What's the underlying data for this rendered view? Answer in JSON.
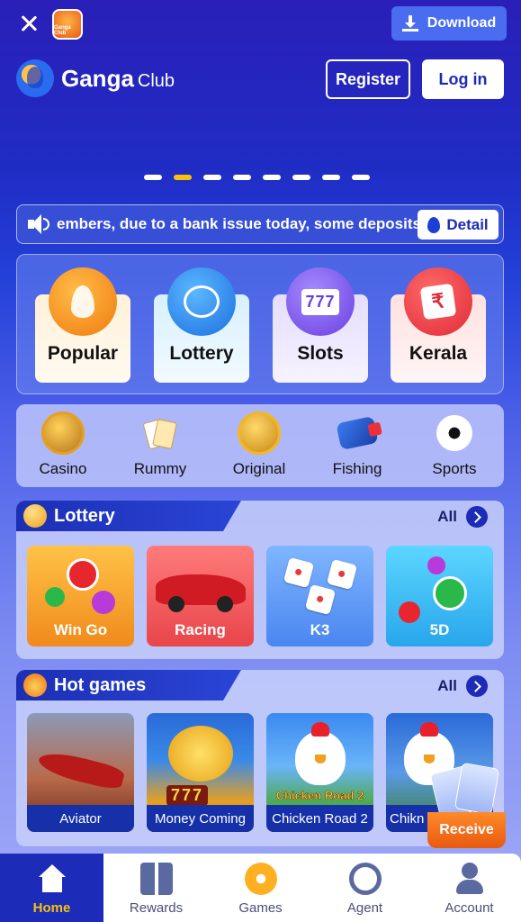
{
  "topbar": {
    "app_icon_label": "Ganga Club",
    "download_label": "Download"
  },
  "header": {
    "brand_name": "Ganga",
    "brand_suffix": "Club",
    "register_label": "Register",
    "login_label": "Log in"
  },
  "banner": {
    "dot_count": 8,
    "active_index": 1
  },
  "notice": {
    "text": "embers, due to a bank issue today, some deposits",
    "detail_label": "Detail"
  },
  "main_categories": [
    {
      "label": "Popular",
      "icon": "flame-icon"
    },
    {
      "label": "Lottery",
      "icon": "lottery-balls-icon"
    },
    {
      "label": "Slots",
      "icon": "slots-777-icon",
      "icon_text": "777"
    },
    {
      "label": "Kerala",
      "icon": "kerala-rupee-icon",
      "icon_text": "₹"
    }
  ],
  "sub_categories": [
    {
      "label": "Casino",
      "icon": "casino-chip-icon"
    },
    {
      "label": "Rummy",
      "icon": "rummy-cards-icon"
    },
    {
      "label": "Original",
      "icon": "crown-coin-icon"
    },
    {
      "label": "Fishing",
      "icon": "fishing-game-icon"
    },
    {
      "label": "Sports",
      "icon": "soccer-ball-icon"
    }
  ],
  "lottery_section": {
    "title": "Lottery",
    "all_label": "All",
    "games": [
      {
        "label": "Win Go"
      },
      {
        "label": "Racing"
      },
      {
        "label": "K3"
      },
      {
        "label": "5D"
      }
    ]
  },
  "hot_section": {
    "title": "Hot games",
    "all_label": "All",
    "games": [
      {
        "label": "Aviator"
      },
      {
        "label": "Money Coming",
        "art_text": "777"
      },
      {
        "label": "Chicken Road 2",
        "art_text": "Chicken Road 2"
      },
      {
        "label": "Chikn"
      }
    ]
  },
  "receive": {
    "label": "Receive"
  },
  "bottom_nav": [
    {
      "label": "Home",
      "icon": "home-icon",
      "active": true
    },
    {
      "label": "Rewards",
      "icon": "gift-icon",
      "active": false
    },
    {
      "label": "Games",
      "icon": "games-icon",
      "active": false
    },
    {
      "label": "Agent",
      "icon": "agent-icon",
      "active": false
    },
    {
      "label": "Account",
      "icon": "account-icon",
      "active": false
    }
  ],
  "colors": {
    "primary": "#1c2bb8",
    "accent": "#f6c20a",
    "download": "#4a6cf0",
    "receive": "#e85a10"
  }
}
